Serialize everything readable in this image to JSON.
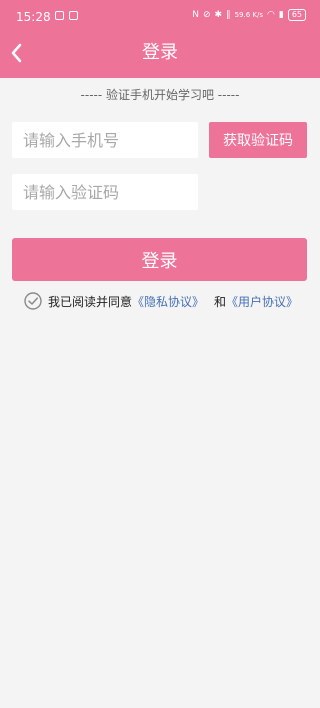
{
  "colors": {
    "accent": "#ee7399",
    "background": "#f4f4f4",
    "link": "#4670b7"
  },
  "status_bar": {
    "time": "15:28",
    "network_speed": "59.6\nK/s",
    "battery": "65",
    "icons": [
      "notification-icon",
      "app-icon",
      "nfc-icon",
      "mute-icon",
      "bluetooth-icon",
      "vibrate-icon",
      "wifi-icon",
      "signal-icon"
    ]
  },
  "header": {
    "title": "登录",
    "back_icon": "back-chevron-icon"
  },
  "subtitle": "----- 验证手机开始学习吧 -----",
  "form": {
    "phone_placeholder": "请输入手机号",
    "code_placeholder": "请输入验证码",
    "code_button": "获取验证码",
    "login_button": "登录"
  },
  "agreement": {
    "prefix": "我已阅读并同意",
    "privacy_link": "《隐私协议》",
    "and": "和",
    "user_link": "《用户协议》"
  }
}
